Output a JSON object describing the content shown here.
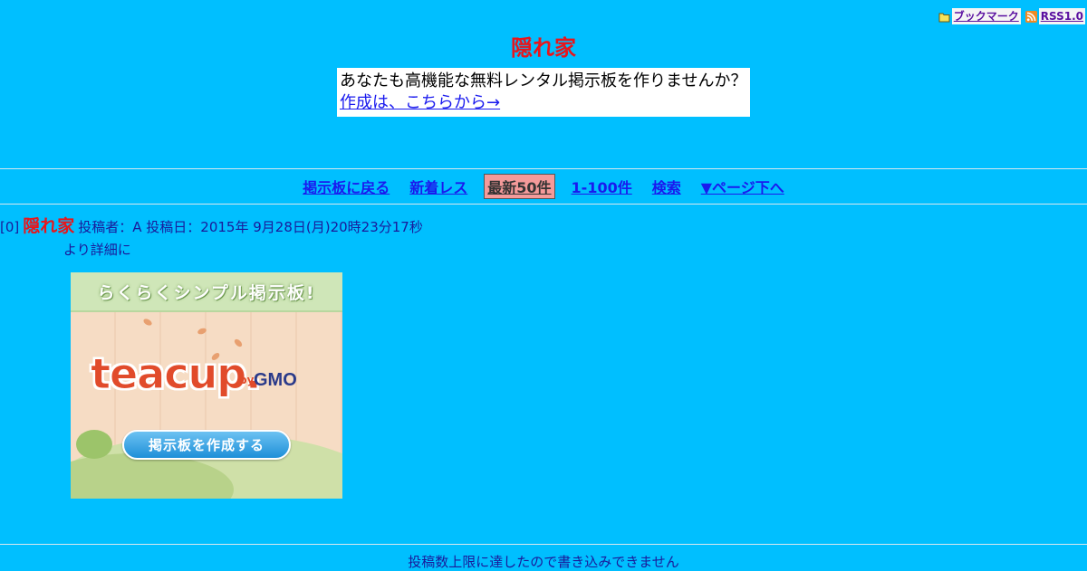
{
  "top_links": {
    "bookmark": "ブックマーク",
    "rss": "RSS1.0"
  },
  "site": {
    "title": "隠れ家"
  },
  "promo": {
    "text": "あなたも高機能な無料レンタル掲示板を作りませんか？",
    "link": "作成は、こちらから→"
  },
  "nav": {
    "items": [
      "掲示板に戻る",
      "新着レス",
      "最新50件",
      "1-100件",
      "検索",
      "▼ページ下へ"
    ],
    "current_index": 2
  },
  "post": {
    "number": "[0]",
    "name": "隠れ家",
    "meta": "投稿者：A 投稿日：2015年 9月28日(月)20時23分17秒",
    "body": "より詳細に"
  },
  "banner": {
    "headline": "らくらくシンプル掲示板!",
    "logo": "teacup.",
    "by": "by",
    "brand": "GMO",
    "cta": "掲示板を作成する"
  },
  "footer": {
    "notice": "投稿数上限に達したので書き込みできません"
  },
  "colors": {
    "background": "#00bfff",
    "title": "#e8151b",
    "link": "#1a1aee",
    "current_nav_bg": "#f49a9a"
  }
}
